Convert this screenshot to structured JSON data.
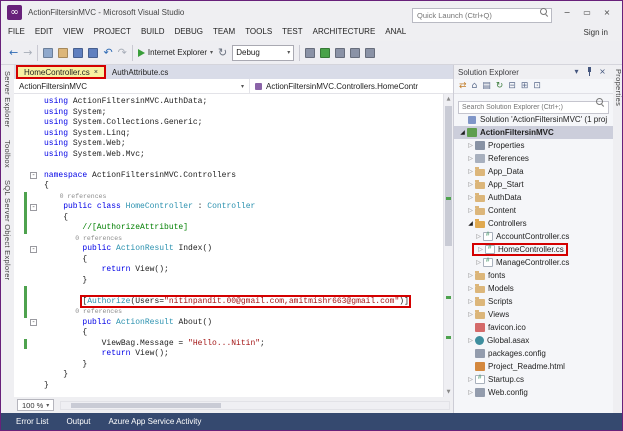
{
  "window": {
    "title": "ActionFiltersinMVC - Microsoft Visual Studio",
    "logo_glyph": "∞",
    "quick_launch_placeholder": "Quick Launch (Ctrl+Q)",
    "sign_in_label": "Sign in",
    "minimize_glyph": "−",
    "restore_glyph": "▭",
    "close_glyph": "×"
  },
  "menu": {
    "items": [
      "FILE",
      "EDIT",
      "VIEW",
      "PROJECT",
      "BUILD",
      "DEBUG",
      "TEAM",
      "TOOLS",
      "TEST",
      "ARCHITECTURE",
      "ANAL"
    ]
  },
  "toolbar": {
    "browser_label": "Internet Explorer",
    "config_label": "Debug",
    "items": [
      {
        "type": "glyph",
        "name": "navigate-backward-icon",
        "glyph": "←",
        "color": "#2F6BB5"
      },
      {
        "type": "glyph",
        "name": "navigate-forward-icon",
        "glyph": "→",
        "color": "#A7ADB8"
      },
      {
        "type": "sep"
      },
      {
        "type": "swatch",
        "name": "new-project-icon",
        "color": "#8FA8CC"
      },
      {
        "type": "swatch",
        "name": "open-file-icon",
        "color": "#DCB67A"
      },
      {
        "type": "swatch",
        "name": "save-icon",
        "color": "#5F7FBF"
      },
      {
        "type": "swatch",
        "name": "save-all-icon",
        "color": "#5F7FBF"
      },
      {
        "type": "glyph",
        "name": "undo-icon",
        "glyph": "↶",
        "color": "#2F6BB5"
      },
      {
        "type": "glyph",
        "name": "redo-icon",
        "glyph": "↷",
        "color": "#A7ADB8"
      },
      {
        "type": "sep"
      },
      {
        "type": "run",
        "name": "start-debug-button"
      },
      {
        "type": "glyph",
        "name": "browser-refresh-icon",
        "glyph": "↻",
        "color": "#6B7280"
      },
      {
        "type": "combo",
        "name": "solution-configurations-dropdown"
      },
      {
        "type": "sep"
      },
      {
        "type": "swatch",
        "name": "find-in-files-icon",
        "color": "#8A92A6"
      },
      {
        "type": "swatch",
        "name": "attach-to-process-icon",
        "color": "#49A249"
      },
      {
        "type": "swatch",
        "name": "comment-lines-icon",
        "color": "#8A92A6"
      },
      {
        "type": "swatch",
        "name": "uncomment-lines-icon",
        "color": "#8A92A6"
      },
      {
        "type": "swatch",
        "name": "navigate-to-icon",
        "color": "#8A92A6"
      }
    ]
  },
  "left_tool_tabs": [
    "Server Explorer",
    "Toolbox",
    "SQL Server Object Explorer"
  ],
  "right_tool_tabs": [
    "Properties"
  ],
  "editor": {
    "tabs": [
      {
        "label": "HomeController.cs",
        "active": true,
        "close_glyph": "×"
      },
      {
        "label": "AuthAttribute.cs",
        "active": false
      }
    ],
    "breadcrumb": {
      "project": "ActionFiltersinMVC",
      "member_path": "ActionFiltersinMVC.Controllers.HomeContr"
    },
    "zoom_level": "100 %",
    "code_lines": [
      {
        "tokens": [
          {
            "t": "k",
            "s": "using"
          },
          {
            "t": "p",
            "s": " ActionFiltersinMVC.AuthData;"
          }
        ]
      },
      {
        "tokens": [
          {
            "t": "k",
            "s": "using"
          },
          {
            "t": "p",
            "s": " System;"
          }
        ]
      },
      {
        "tokens": [
          {
            "t": "k",
            "s": "using"
          },
          {
            "t": "p",
            "s": " System.Collections.Generic;"
          }
        ]
      },
      {
        "tokens": [
          {
            "t": "k",
            "s": "using"
          },
          {
            "t": "p",
            "s": " System.Linq;"
          }
        ]
      },
      {
        "tokens": [
          {
            "t": "k",
            "s": "using"
          },
          {
            "t": "p",
            "s": " System.Web;"
          }
        ]
      },
      {
        "tokens": [
          {
            "t": "k",
            "s": "using"
          },
          {
            "t": "p",
            "s": " System.Web.Mvc;"
          }
        ]
      },
      {
        "tokens": []
      },
      {
        "fold": true,
        "tokens": [
          {
            "t": "k",
            "s": "namespace"
          },
          {
            "t": "p",
            "s": " ActionFiltersinMVC.Controllers"
          }
        ]
      },
      {
        "tokens": [
          {
            "t": "p",
            "s": "{"
          }
        ]
      },
      {
        "change": true,
        "tokens": [
          {
            "t": "l",
            "s": "    0 references"
          }
        ]
      },
      {
        "change": true,
        "fold": true,
        "tokens": [
          {
            "t": "p",
            "s": "    "
          },
          {
            "t": "k",
            "s": "public"
          },
          {
            "t": "p",
            "s": " "
          },
          {
            "t": "k",
            "s": "class"
          },
          {
            "t": "p",
            "s": " "
          },
          {
            "t": "t",
            "s": "HomeController"
          },
          {
            "t": "p",
            "s": " : "
          },
          {
            "t": "t",
            "s": "Controller"
          }
        ]
      },
      {
        "change": true,
        "tokens": [
          {
            "t": "p",
            "s": "    {"
          }
        ]
      },
      {
        "change": true,
        "tokens": [
          {
            "t": "p",
            "s": "        "
          },
          {
            "t": "c",
            "s": "//[AuthorizeAttribute]"
          }
        ]
      },
      {
        "tokens": [
          {
            "t": "l",
            "s": "        0 references"
          }
        ]
      },
      {
        "fold": true,
        "tokens": [
          {
            "t": "p",
            "s": "        "
          },
          {
            "t": "k",
            "s": "public"
          },
          {
            "t": "p",
            "s": " "
          },
          {
            "t": "t",
            "s": "ActionResult"
          },
          {
            "t": "p",
            "s": " Index()"
          }
        ]
      },
      {
        "tokens": [
          {
            "t": "p",
            "s": "        {"
          }
        ]
      },
      {
        "tokens": [
          {
            "t": "p",
            "s": "            "
          },
          {
            "t": "k",
            "s": "return"
          },
          {
            "t": "p",
            "s": " View();"
          }
        ]
      },
      {
        "tokens": [
          {
            "t": "p",
            "s": "        }"
          }
        ]
      },
      {
        "change": true,
        "tokens": []
      },
      {
        "change": true,
        "boxed": true,
        "tokens": [
          {
            "t": "p",
            "s": "        "
          },
          {
            "t": "p",
            "s": "["
          },
          {
            "t": "t",
            "s": "Authorize"
          },
          {
            "t": "p",
            "s": "(Users="
          },
          {
            "t": "s",
            "s": "\"nitinpandit.00@gmail.com,amitmishr663@gmail.com\""
          },
          {
            "t": "p",
            "s": ")]"
          }
        ]
      },
      {
        "change": true,
        "tokens": [
          {
            "t": "l",
            "s": "        0 references"
          }
        ]
      },
      {
        "fold": true,
        "tokens": [
          {
            "t": "p",
            "s": "        "
          },
          {
            "t": "k",
            "s": "public"
          },
          {
            "t": "p",
            "s": " "
          },
          {
            "t": "t",
            "s": "ActionResult"
          },
          {
            "t": "p",
            "s": " About()"
          }
        ]
      },
      {
        "tokens": [
          {
            "t": "p",
            "s": "        {"
          }
        ]
      },
      {
        "change": true,
        "tokens": [
          {
            "t": "p",
            "s": "            ViewBag.Message = "
          },
          {
            "t": "s",
            "s": "\"Hello...Nitin\""
          },
          {
            "t": "p",
            "s": ";"
          }
        ]
      },
      {
        "tokens": [
          {
            "t": "p",
            "s": "            "
          },
          {
            "t": "k",
            "s": "return"
          },
          {
            "t": "p",
            "s": " View();"
          }
        ]
      },
      {
        "tokens": [
          {
            "t": "p",
            "s": "        }"
          }
        ]
      },
      {
        "tokens": [
          {
            "t": "p",
            "s": "    }"
          }
        ]
      },
      {
        "tokens": [
          {
            "t": "p",
            "s": "}"
          }
        ]
      }
    ]
  },
  "bottom_tabs": [
    "Error List",
    "Output",
    "Azure App Service Activity"
  ],
  "solution_explorer": {
    "title": "Solution Explorer",
    "header_icons": [
      {
        "name": "window-position-icon",
        "glyph": "▾"
      },
      {
        "name": "pin-icon",
        "glyph": ""
      },
      {
        "name": "close-icon",
        "glyph": "×"
      }
    ],
    "toolbar_icons": [
      {
        "name": "sync-with-active-document-icon",
        "glyph": "⇄",
        "color": "#C27D2A"
      },
      {
        "name": "home-icon",
        "glyph": "⌂",
        "color": "#5B6B8C"
      },
      {
        "name": "switch-views-icon",
        "glyph": "▤",
        "color": "#5B6B8C"
      },
      {
        "name": "refresh-icon",
        "glyph": "↻",
        "color": "#3E7E3E"
      },
      {
        "name": "collapse-all-icon",
        "glyph": "⊟",
        "color": "#5B6B8C"
      },
      {
        "name": "show-all-files-icon",
        "glyph": "⊞",
        "color": "#5B6B8C"
      },
      {
        "name": "properties-icon",
        "glyph": "⊡",
        "color": "#5B6B8C"
      }
    ],
    "search_placeholder": "Search Solution Explorer (Ctrl+;)",
    "tree": [
      {
        "indent": 0,
        "arrow": "",
        "icon": "solution",
        "label": "Solution 'ActionFiltersinMVC' (1 proj"
      },
      {
        "indent": 0,
        "arrow": "e",
        "icon": "csproj",
        "label": "ActionFiltersinMVC",
        "selected": true,
        "bold": true
      },
      {
        "indent": 1,
        "arrow": "c",
        "icon": "properties",
        "label": "Properties"
      },
      {
        "indent": 1,
        "arrow": "c",
        "icon": "references",
        "label": "References"
      },
      {
        "indent": 1,
        "arrow": "c",
        "icon": "folder",
        "label": "App_Data"
      },
      {
        "indent": 1,
        "arrow": "c",
        "icon": "folder",
        "label": "App_Start"
      },
      {
        "indent": 1,
        "arrow": "c",
        "icon": "folder",
        "label": "AuthData"
      },
      {
        "indent": 1,
        "arrow": "c",
        "icon": "folder",
        "label": "Content"
      },
      {
        "indent": 1,
        "arrow": "e",
        "icon": "folder-open",
        "label": "Controllers"
      },
      {
        "indent": 2,
        "arrow": "c",
        "icon": "csfile",
        "label": "AccountController.cs"
      },
      {
        "indent": 2,
        "arrow": "c",
        "icon": "csfile",
        "label": "HomeController.cs",
        "highlighted": true
      },
      {
        "indent": 2,
        "arrow": "c",
        "icon": "csfile",
        "label": "ManageController.cs"
      },
      {
        "indent": 1,
        "arrow": "c",
        "icon": "folder",
        "label": "fonts"
      },
      {
        "indent": 1,
        "arrow": "c",
        "icon": "folder",
        "label": "Models"
      },
      {
        "indent": 1,
        "arrow": "c",
        "icon": "folder",
        "label": "Scripts"
      },
      {
        "indent": 1,
        "arrow": "c",
        "icon": "folder",
        "label": "Views"
      },
      {
        "indent": 1,
        "arrow": "",
        "icon": "image",
        "label": "favicon.ico"
      },
      {
        "indent": 1,
        "arrow": "c",
        "icon": "globe",
        "label": "Global.asax"
      },
      {
        "indent": 1,
        "arrow": "",
        "icon": "config",
        "label": "packages.config"
      },
      {
        "indent": 1,
        "arrow": "",
        "icon": "html",
        "label": "Project_Readme.html"
      },
      {
        "indent": 1,
        "arrow": "c",
        "icon": "csfile",
        "label": "Startup.cs"
      },
      {
        "indent": 1,
        "arrow": "c",
        "icon": "config",
        "label": "Web.config"
      }
    ]
  },
  "colors": {
    "accent_purple": "#68217A",
    "annotation_red": "#D40000",
    "change_bar_green": "#4EA24E",
    "active_tab_yellow": "#F8F1A2",
    "statusbar_navy": "#35496F"
  }
}
